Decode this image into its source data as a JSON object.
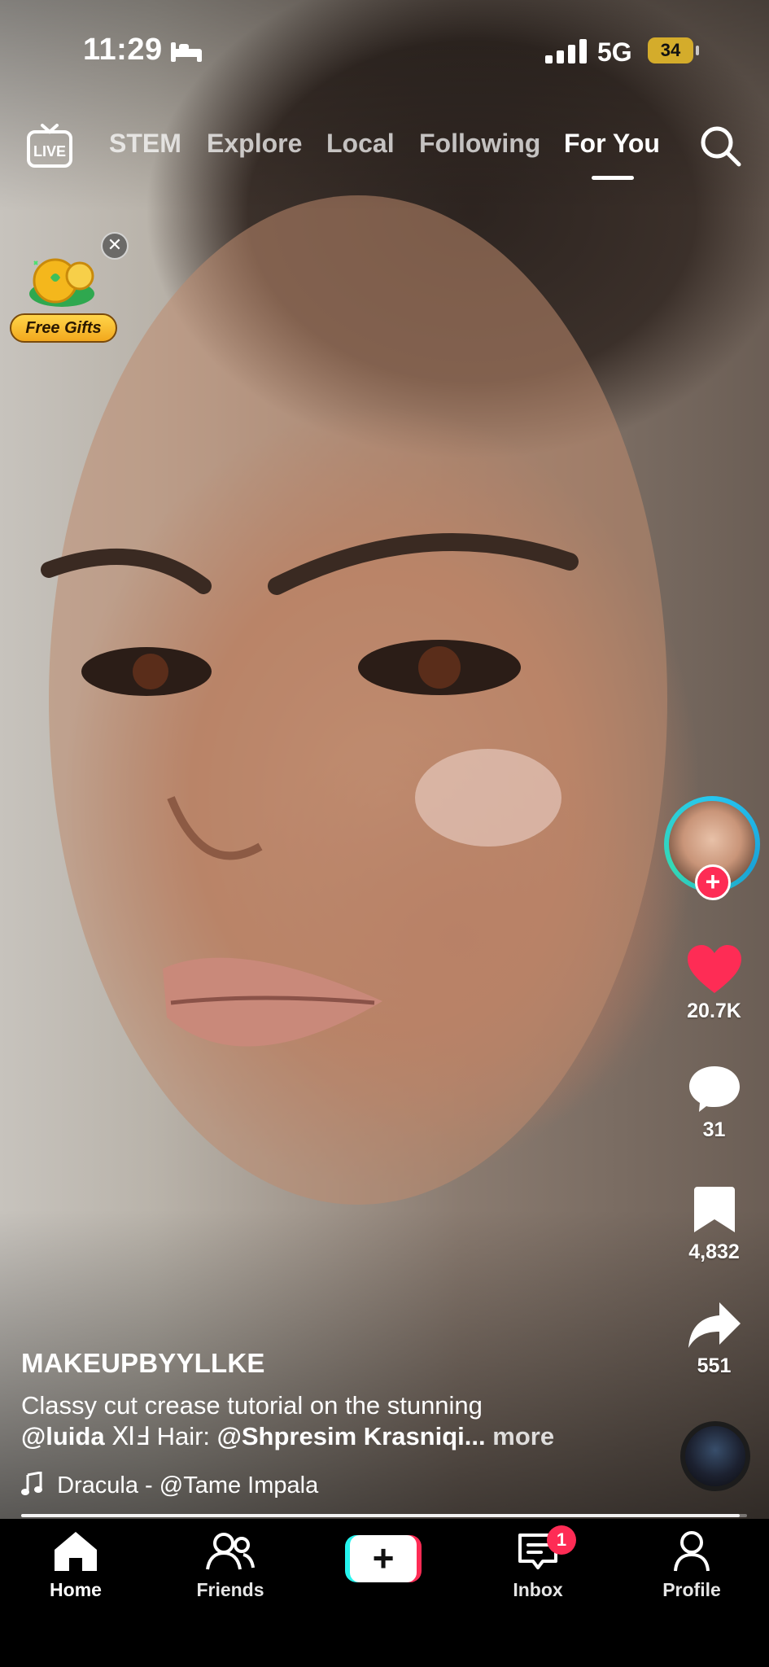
{
  "status_bar": {
    "time": "11:29",
    "network": "5G",
    "battery": "34"
  },
  "top_nav": {
    "live_label": "LIVE",
    "tabs": [
      {
        "label": "STEM",
        "active": false
      },
      {
        "label": "Explore",
        "active": false
      },
      {
        "label": "Local",
        "active": false
      },
      {
        "label": "Following",
        "active": false
      },
      {
        "label": "For You",
        "active": true
      }
    ]
  },
  "promo": {
    "label": "Free Gifts"
  },
  "rail": {
    "likes": "20.7K",
    "comments": "31",
    "saves": "4,832",
    "shares": "551"
  },
  "post": {
    "author": "MAKEUPBYYLLKE",
    "description_start": "Classy cut crease tutorial on the stunning",
    "mention_1": "@luida",
    "symbols": " ⅪℲ ",
    "hair_label": "Hair:",
    "mention_2": "@Shpresim Krasniqi...",
    "more": "more",
    "sound": "Dracula - @Tame Impala",
    "progress": 0.99
  },
  "bottom_nav": {
    "home": "Home",
    "friends": "Friends",
    "inbox": "Inbox",
    "inbox_badge": "1",
    "profile": "Profile"
  },
  "colors": {
    "accent_red": "#fe2c55",
    "accent_cyan": "#25f4ee",
    "battery": "#d4ac2b"
  }
}
